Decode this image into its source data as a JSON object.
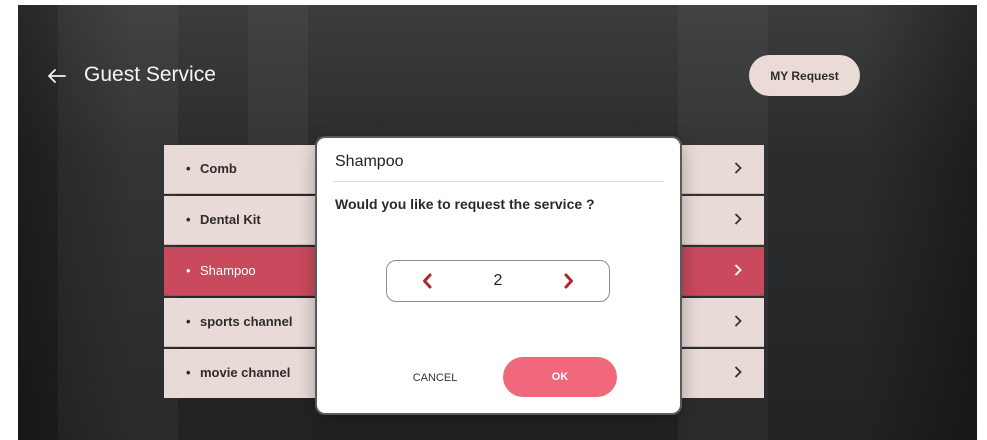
{
  "header": {
    "back_icon": "arrow-left-icon",
    "title": "Guest Service",
    "my_request_label": "MY Request"
  },
  "service_list": {
    "items": [
      {
        "label": "Comb",
        "selected": false
      },
      {
        "label": "Dental Kit",
        "selected": false
      },
      {
        "label": "Shampoo",
        "selected": true
      },
      {
        "label": "sports channel",
        "selected": false
      },
      {
        "label": "movie channel",
        "selected": false
      }
    ],
    "bullet": "•",
    "chevron_icon": "chevron-right-icon"
  },
  "dialog": {
    "title": "Shampoo",
    "question": "Would you like to request the service ?",
    "quantity": "2",
    "decrement_icon": "chevron-left-icon",
    "increment_icon": "chevron-right-icon",
    "cancel_label": "CANCEL",
    "ok_label": "OK"
  },
  "colors": {
    "accent": "#c94a5c",
    "ok_button": "#f1687d",
    "stepper_chevron": "#b3262e",
    "list_row": "#e8dbd7",
    "pill_button": "#eadbd6"
  }
}
